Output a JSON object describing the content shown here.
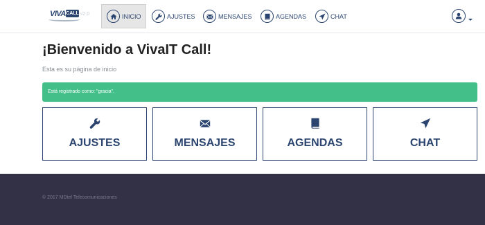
{
  "header": {
    "logo": {
      "brand": "VIVAit",
      "badge": "CALL",
      "version": "v2.0"
    },
    "nav": [
      {
        "label": "INICIO",
        "icon": "home-icon",
        "active": true
      },
      {
        "label": "AJUSTES",
        "icon": "wrench-icon",
        "active": false
      },
      {
        "label": "MENSAJES",
        "icon": "envelope-icon",
        "active": false
      },
      {
        "label": "AGENDAS",
        "icon": "book-icon",
        "active": false
      },
      {
        "label": "CHAT",
        "icon": "send-icon",
        "active": false
      }
    ],
    "user_icon": "user-icon"
  },
  "main": {
    "title": "¡Bienvenido a VivaIT Call!",
    "subtitle": "Esta es su página de inicio",
    "alert": "Está registrado como: \"gracia\".",
    "tiles": [
      {
        "label": "AJUSTES",
        "icon": "wrench-icon"
      },
      {
        "label": "MENSAJES",
        "icon": "envelope-icon"
      },
      {
        "label": "AGENDAS",
        "icon": "book-icon"
      },
      {
        "label": "CHAT",
        "icon": "send-icon"
      }
    ]
  },
  "footer": {
    "text": "© 2017 MDtel Telecomunicaciones"
  },
  "colors": {
    "primary": "#2b4570",
    "success": "#43bf8a",
    "footer_bg": "#333146"
  }
}
